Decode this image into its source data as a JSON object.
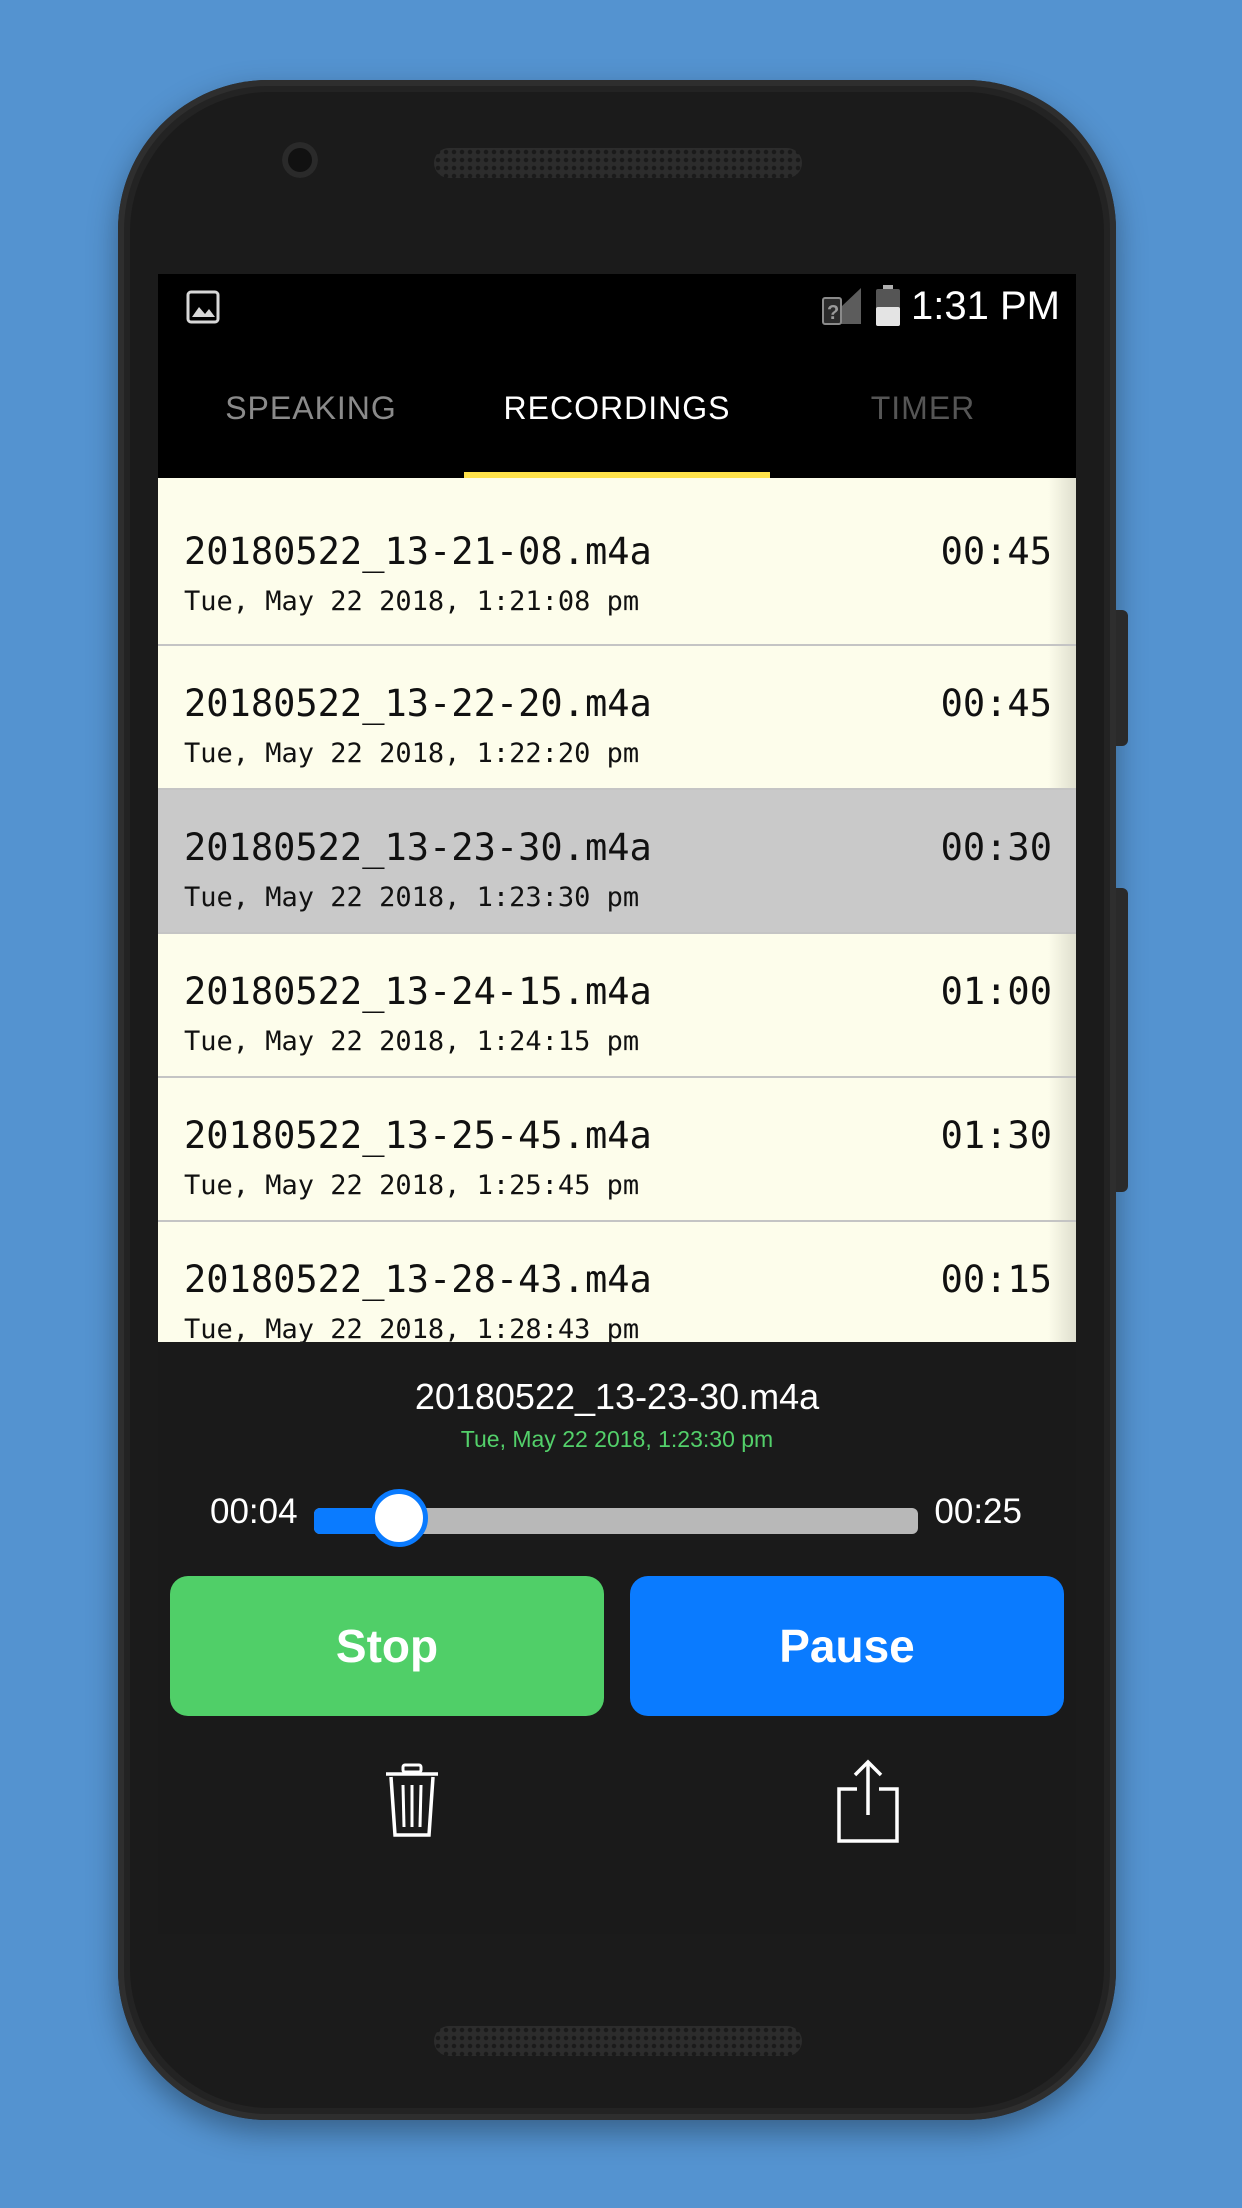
{
  "status_bar": {
    "time": "1:31 PM",
    "icons": [
      "image-notification-icon",
      "no-sim-signal-icon",
      "battery-icon"
    ]
  },
  "tabs": [
    {
      "label": "SPEAKING",
      "active": false
    },
    {
      "label": "RECORDINGS",
      "active": true
    },
    {
      "label": "TIMER",
      "active": false
    }
  ],
  "recordings": [
    {
      "file": "20180522_13-21-08.m4a",
      "date": "Tue, May 22 2018, 1:21:08 pm",
      "duration": "00:45",
      "selected": false
    },
    {
      "file": "20180522_13-22-20.m4a",
      "date": "Tue, May 22 2018, 1:22:20 pm",
      "duration": "00:45",
      "selected": false
    },
    {
      "file": "20180522_13-23-30.m4a",
      "date": "Tue, May 22 2018, 1:23:30 pm",
      "duration": "00:30",
      "selected": true
    },
    {
      "file": "20180522_13-24-15.m4a",
      "date": "Tue, May 22 2018, 1:24:15 pm",
      "duration": "01:00",
      "selected": false
    },
    {
      "file": "20180522_13-25-45.m4a",
      "date": "Tue, May 22 2018, 1:25:45 pm",
      "duration": "01:30",
      "selected": false
    },
    {
      "file": "20180522_13-28-43.m4a",
      "date": "Tue, May 22 2018, 1:28:43 pm",
      "duration": "00:15",
      "selected": false
    }
  ],
  "player": {
    "file": "20180522_13-23-30.m4a",
    "date": "Tue, May 22 2018, 1:23:30 pm",
    "elapsed": "00:04",
    "remaining": "00:25",
    "progress": 0.14,
    "stop_label": "Stop",
    "pause_label": "Pause",
    "icons": [
      "trash-icon",
      "share-icon"
    ]
  },
  "colors": {
    "background": "#5493d0",
    "tab_indicator": "#ffe24a",
    "list_row": "#fdfdeb",
    "selected_row": "#c9c9c9",
    "stop_button": "#50cf68",
    "pause_button": "#0a7bff",
    "date_accent": "#53d06a"
  }
}
